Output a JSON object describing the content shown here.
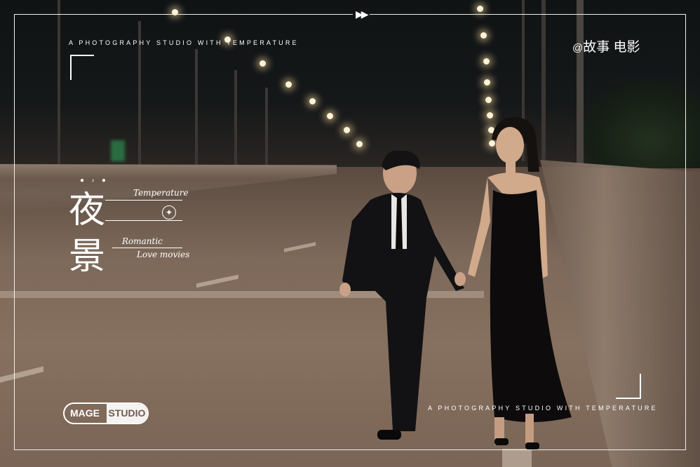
{
  "top_tagline": "A PHOTOGRAPHY STUDIO WITH TEMPERATURE",
  "bottom_tagline": "A PHOTOGRAPHY STUDIO WITH TEMPERATURE",
  "credit": {
    "at": "@",
    "text": "故事 电影"
  },
  "title_chars": [
    "夜",
    "景"
  ],
  "script_texts": {
    "temperature": "Temperature",
    "romantic": "Romantic",
    "love_movies": "Love movies"
  },
  "logo": {
    "left": "MAGE",
    "right": "STUDIO"
  },
  "icons": {
    "fast_forward": "fast-forward-icon",
    "star": "four-point-star-icon"
  },
  "colors": {
    "frame": "#f2f0ec",
    "text": "#ffffff",
    "dress": "#0d0b0b",
    "suit": "#121214"
  }
}
